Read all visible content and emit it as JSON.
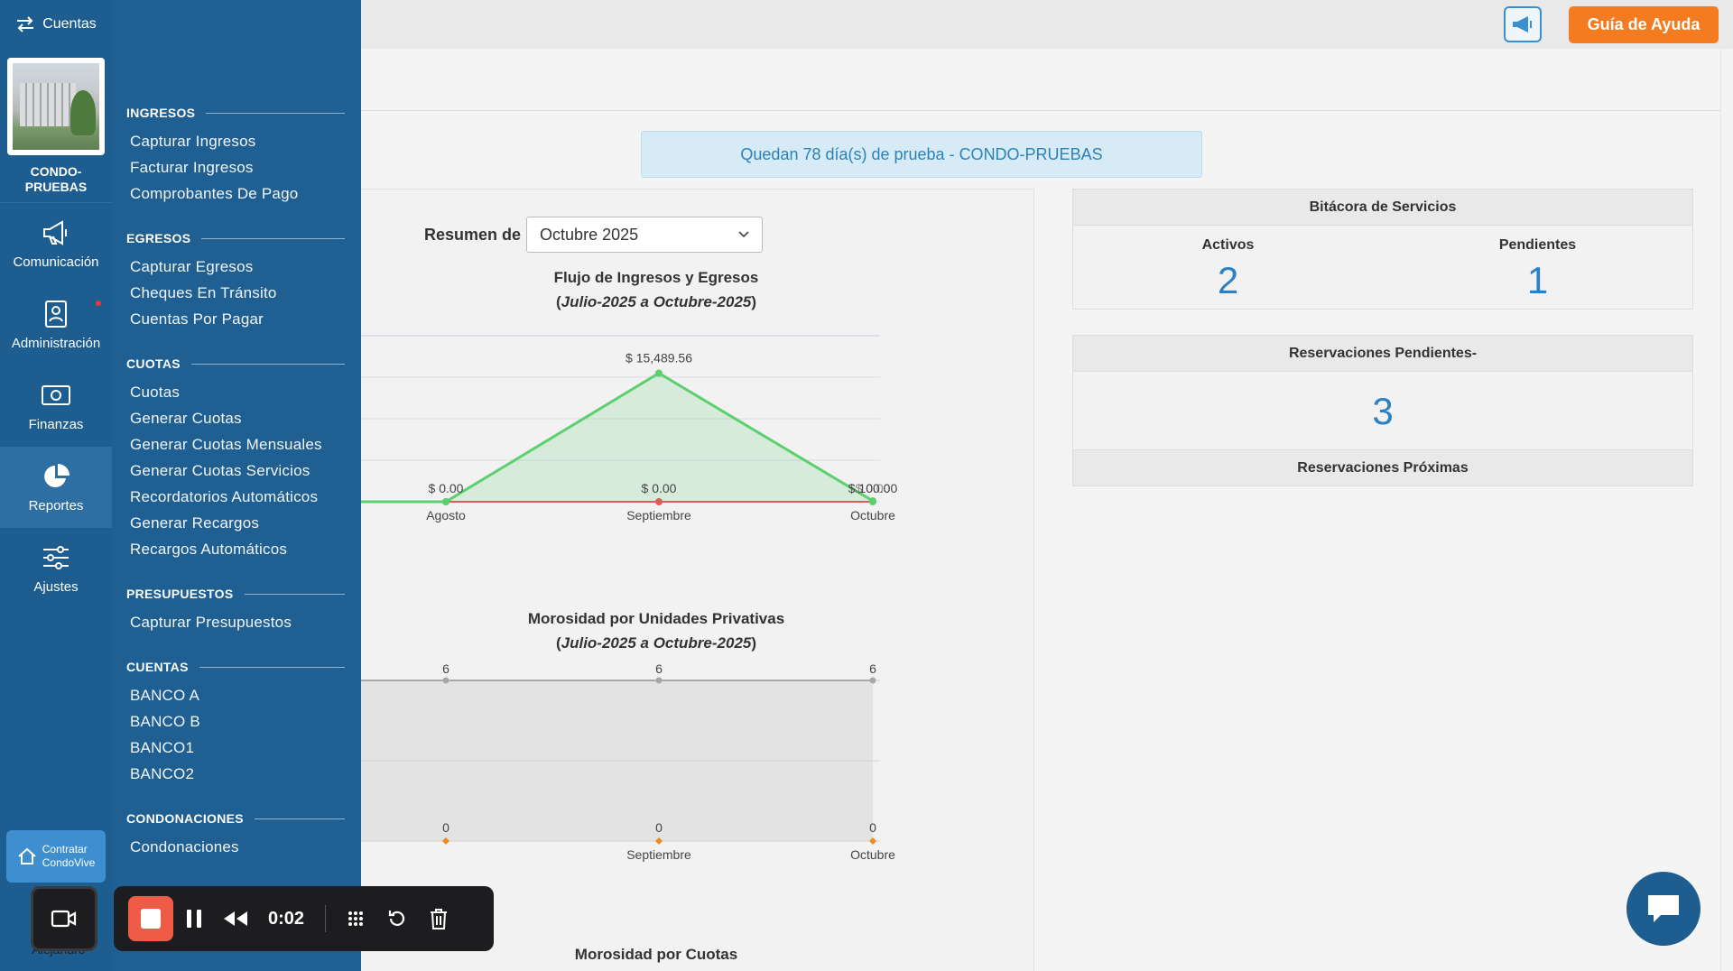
{
  "rail": {
    "switch_label": "Cuentas",
    "condo_name_line1": "CONDO-",
    "condo_name_line2": "PRUEBAS",
    "items": [
      {
        "label": "Comunicación",
        "icon": "megaphone-icon"
      },
      {
        "label": "Administración",
        "icon": "contact-card-icon"
      },
      {
        "label": "Finanzas",
        "icon": "money-icon"
      },
      {
        "label": "Reportes",
        "icon": "pie-chart-icon"
      },
      {
        "label": "Ajustes",
        "icon": "sliders-icon"
      }
    ],
    "contract_line1": "Contratar",
    "contract_line2": "CondoVive",
    "user_label": "Alejandro"
  },
  "submenu": {
    "sections": [
      {
        "title": "INGRESOS",
        "links": [
          "Capturar Ingresos",
          "Facturar Ingresos",
          "Comprobantes De Pago"
        ]
      },
      {
        "title": "EGRESOS",
        "links": [
          "Capturar Egresos",
          "Cheques En Tránsito",
          "Cuentas Por Pagar"
        ]
      },
      {
        "title": "CUOTAS",
        "links": [
          "Cuotas",
          "Generar Cuotas",
          "Generar Cuotas Mensuales",
          "Generar Cuotas Servicios",
          "Recordatorios Automáticos",
          "Generar Recargos",
          "Recargos Automáticos"
        ]
      },
      {
        "title": "PRESUPUESTOS",
        "links": [
          "Capturar Presupuestos"
        ]
      },
      {
        "title": "CUENTAS",
        "links": [
          "BANCO A",
          "BANCO B",
          "BANCO1",
          "BANCO2"
        ]
      },
      {
        "title": "CONDONACIONES",
        "links": [
          "Condonaciones"
        ]
      }
    ]
  },
  "topbar": {
    "help_button": "Guía de Ayuda",
    "help_color": "#f47b1f"
  },
  "trial_banner": "Quedan 78 día(s) de prueba - CONDO-PRUEBAS",
  "summary": {
    "label": "Resumen de",
    "selected_month": "Octubre 2025"
  },
  "chart1_title": {
    "line1": "Flujo de Ingresos y Egresos",
    "range": "Julio-2025 a Octubre-2025"
  },
  "chart2_title": {
    "line1": "Morosidad por Unidades Privativas",
    "range": "Julio-2025 a Octubre-2025"
  },
  "chart3_title": {
    "line1": "Morosidad por Cuotas"
  },
  "chart_data": [
    {
      "type": "area",
      "title": "Flujo de Ingresos y Egresos",
      "subtitle": "Julio-2025 a Octubre-2025",
      "categories": [
        "Agosto",
        "Septiembre",
        "Octubre"
      ],
      "series": [
        {
          "values": [
            0,
            15489.56,
            100
          ],
          "color": "#5ccf6e"
        },
        {
          "values": [
            0,
            0,
            0
          ],
          "color": "#e05b5b"
        }
      ],
      "point_labels": [
        "$ 0.00",
        "$ 15,489.56",
        "$ 100.00"
      ],
      "point_labels_series2": [
        "$ 0.00",
        "$ 0.00",
        "$ 0.00"
      ],
      "ylim": [
        0,
        20000
      ]
    },
    {
      "type": "area",
      "title": "Morosidad por Unidades Privativas",
      "subtitle": "Julio-2025 a Octubre-2025",
      "categories": [
        "Agosto",
        "Septiembre",
        "Octubre"
      ],
      "visible_category_labels": [
        "",
        "Septiembre",
        "Octubre"
      ],
      "series": [
        {
          "values": [
            6,
            6,
            6
          ],
          "color": "#a8a8a8"
        },
        {
          "values": [
            0,
            0,
            0
          ],
          "color": "#f08a24"
        }
      ],
      "ylim": [
        0,
        6
      ]
    }
  ],
  "services_log": {
    "title": "Bitácora de Servicios",
    "active_label": "Activos",
    "active_count": "2",
    "pending_label": "Pendientes",
    "pending_count": "1"
  },
  "reservations": {
    "pending_title": "Reservaciones Pendientes-",
    "pending_count": "3",
    "upcoming_title": "Reservaciones Próximas"
  },
  "recorder": {
    "elapsed": "0:02"
  }
}
